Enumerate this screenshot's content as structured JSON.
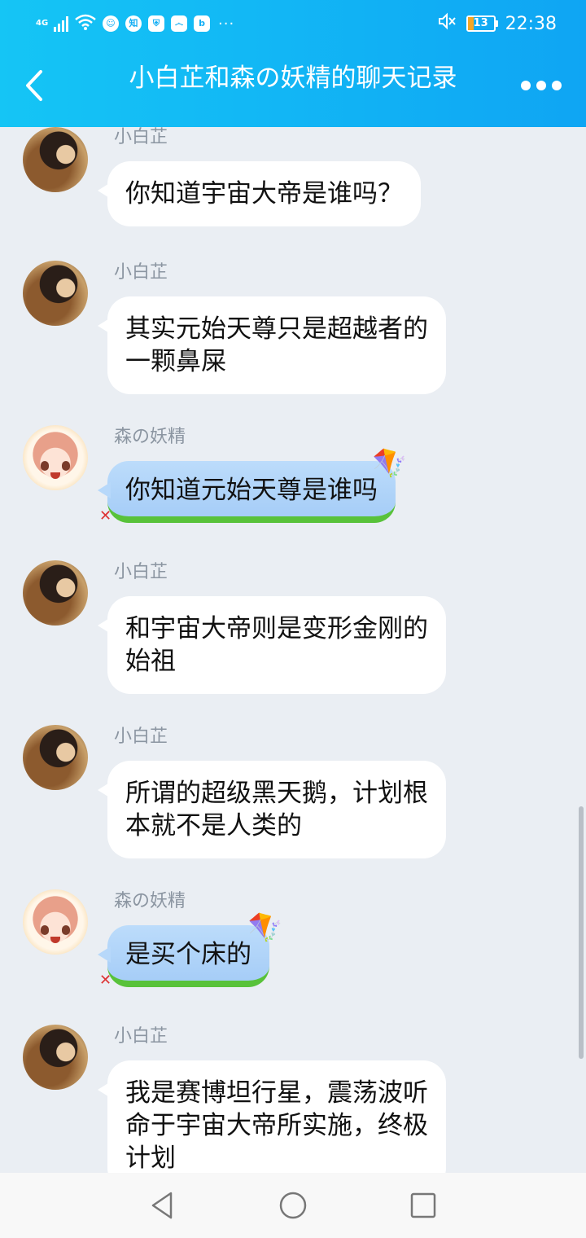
{
  "status_bar": {
    "network": "4G",
    "battery": "13",
    "time": "22:38",
    "app_icons": [
      "qq-icon",
      "zhihu-icon",
      "shield-icon",
      "baidu-icon",
      "bluebox-icon"
    ],
    "app_glyphs": [
      "☺",
      "知",
      "⛨",
      "෴",
      "b"
    ],
    "more": "···",
    "mute_glyph": "🔇"
  },
  "header": {
    "title": "小白芷和森の妖精的聊天记录",
    "accent_color": "#12b7f5"
  },
  "messages": [
    {
      "sender": "小白芷",
      "text_lines": [
        "你知道宇宙大帝是谁吗？"
      ]
    },
    {
      "sender": "小白芷",
      "text_lines": [
        "其实元始天尊只是超越者的",
        "一颗鼻屎"
      ]
    },
    {
      "sender": "森の妖精",
      "text_lines": [
        "你知道元始天尊是谁吗"
      ]
    },
    {
      "sender": "小白芷",
      "text_lines": [
        "和宇宙大帝则是变形金刚的",
        "始祖"
      ]
    },
    {
      "sender": "小白芷",
      "text_lines": [
        "所谓的超级黑天鹅，计划根",
        "本就不是人类的"
      ]
    },
    {
      "sender": "森の妖精",
      "text_lines": [
        "是买个床的"
      ]
    },
    {
      "sender": "小白芷",
      "text_lines": [
        "我是赛博坦行星，震荡波听",
        "命于宇宙大帝所实施，终极",
        "计划"
      ]
    }
  ],
  "decor": {
    "kite": "🪁",
    "pin": "✕"
  }
}
